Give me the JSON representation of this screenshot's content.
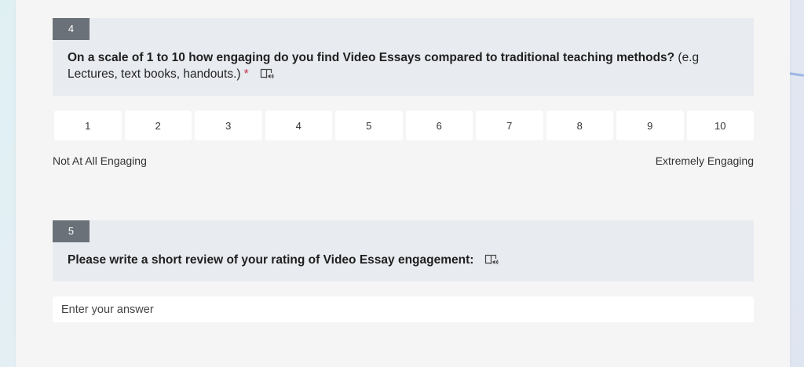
{
  "questions": [
    {
      "number": "4",
      "title_bold": "On a scale of 1 to 10 how engaging do you find Video Essays compared to traditional teaching methods?",
      "title_rest": " (e.g Lectures, text books, handouts.)",
      "required_mark": "*",
      "reader_icon": "immersive-reader-icon",
      "scale": [
        "1",
        "2",
        "3",
        "4",
        "5",
        "6",
        "7",
        "8",
        "9",
        "10"
      ],
      "low_label": "Not At All Engaging",
      "high_label": "Extremely Engaging"
    },
    {
      "number": "5",
      "title_bold": "Please write a short review of your rating of Video Essay engagement:",
      "reader_icon": "immersive-reader-icon",
      "answer_placeholder": "Enter your answer"
    }
  ],
  "colors": {
    "number_badge": "#6b7178",
    "header_bg": "#e8ebef",
    "required": "#c4314b"
  }
}
